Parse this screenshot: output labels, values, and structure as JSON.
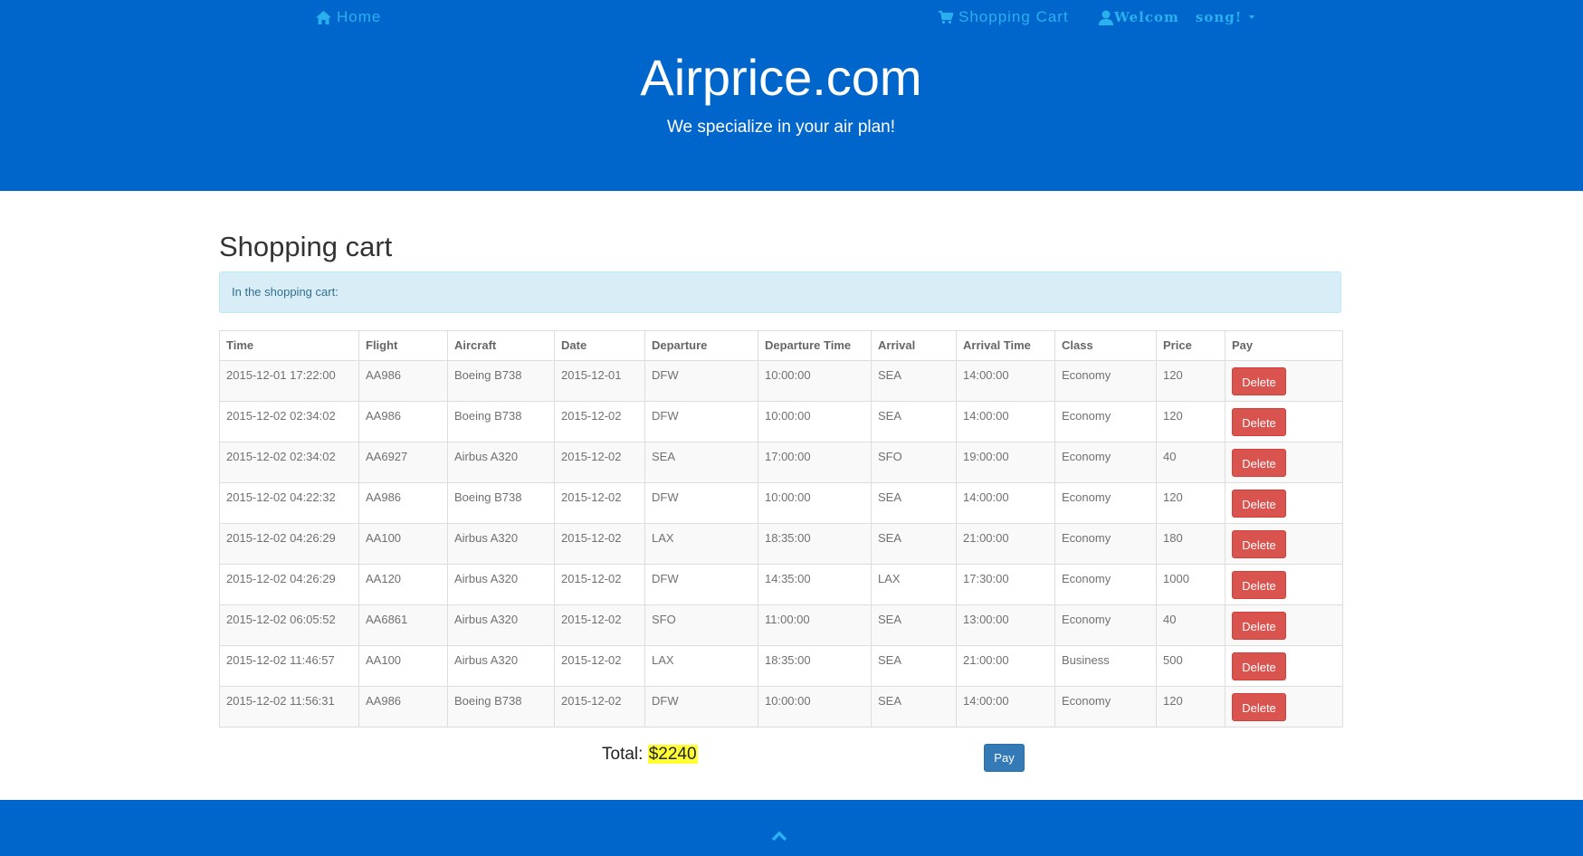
{
  "nav": {
    "home_label": "Home",
    "cart_label": "Shopping Cart",
    "welcome_label": "Welcom",
    "username": "song!"
  },
  "header": {
    "brand": "Airprice.com",
    "tagline": "We specialize in your air plan!"
  },
  "main": {
    "title": "Shopping cart",
    "alert_text": "In the shopping cart:",
    "columns": [
      "Time",
      "Flight",
      "Aircraft",
      "Date",
      "Departure",
      "Departure Time",
      "Arrival",
      "Arrival Time",
      "Class",
      "Price",
      "Pay"
    ],
    "rows": [
      {
        "time": "2015-12-01 17:22:00",
        "flight": "AA986",
        "aircraft": "Boeing B738",
        "date": "2015-12-01",
        "departure": "DFW",
        "departure_time": "10:00:00",
        "arrival": "SEA",
        "arrival_time": "14:00:00",
        "class": "Economy",
        "price": "120",
        "action": "Delete"
      },
      {
        "time": "2015-12-02 02:34:02",
        "flight": "AA986",
        "aircraft": "Boeing B738",
        "date": "2015-12-02",
        "departure": "DFW",
        "departure_time": "10:00:00",
        "arrival": "SEA",
        "arrival_time": "14:00:00",
        "class": "Economy",
        "price": "120",
        "action": "Delete"
      },
      {
        "time": "2015-12-02 02:34:02",
        "flight": "AA6927",
        "aircraft": "Airbus A320",
        "date": "2015-12-02",
        "departure": "SEA",
        "departure_time": "17:00:00",
        "arrival": "SFO",
        "arrival_time": "19:00:00",
        "class": "Economy",
        "price": "40",
        "action": "Delete"
      },
      {
        "time": "2015-12-02 04:22:32",
        "flight": "AA986",
        "aircraft": "Boeing B738",
        "date": "2015-12-02",
        "departure": "DFW",
        "departure_time": "10:00:00",
        "arrival": "SEA",
        "arrival_time": "14:00:00",
        "class": "Economy",
        "price": "120",
        "action": "Delete"
      },
      {
        "time": "2015-12-02 04:26:29",
        "flight": "AA100",
        "aircraft": "Airbus A320",
        "date": "2015-12-02",
        "departure": "LAX",
        "departure_time": "18:35:00",
        "arrival": "SEA",
        "arrival_time": "21:00:00",
        "class": "Economy",
        "price": "180",
        "action": "Delete"
      },
      {
        "time": "2015-12-02 04:26:29",
        "flight": "AA120",
        "aircraft": "Airbus A320",
        "date": "2015-12-02",
        "departure": "DFW",
        "departure_time": "14:35:00",
        "arrival": "LAX",
        "arrival_time": "17:30:00",
        "class": "Economy",
        "price": "1000",
        "action": "Delete"
      },
      {
        "time": "2015-12-02 06:05:52",
        "flight": "AA6861",
        "aircraft": "Airbus A320",
        "date": "2015-12-02",
        "departure": "SFO",
        "departure_time": "11:00:00",
        "arrival": "SEA",
        "arrival_time": "13:00:00",
        "class": "Economy",
        "price": "40",
        "action": "Delete"
      },
      {
        "time": "2015-12-02 11:46:57",
        "flight": "AA100",
        "aircraft": "Airbus A320",
        "date": "2015-12-02",
        "departure": "LAX",
        "departure_time": "18:35:00",
        "arrival": "SEA",
        "arrival_time": "21:00:00",
        "class": "Business",
        "price": "500",
        "action": "Delete"
      },
      {
        "time": "2015-12-02 11:56:31",
        "flight": "AA986",
        "aircraft": "Boeing B738",
        "date": "2015-12-02",
        "departure": "DFW",
        "departure_time": "10:00:00",
        "arrival": "SEA",
        "arrival_time": "14:00:00",
        "class": "Economy",
        "price": "120",
        "action": "Delete"
      }
    ],
    "total_label": "Total:",
    "total_amount": "$2240",
    "pay_label": "Pay"
  },
  "icons": {
    "home": "home-icon",
    "cart": "shopping-cart-icon",
    "user": "user-icon",
    "caret": "caret-down-icon",
    "back_to_top": "chevron-up-icon"
  },
  "colors": {
    "header_bg": "#0066CC",
    "nav_link": "#2ab0ee",
    "delete_button": "#d9534f",
    "pay_button": "#337ab7",
    "alert_bg": "#d9edf7",
    "total_highlight": "#ffff33"
  }
}
